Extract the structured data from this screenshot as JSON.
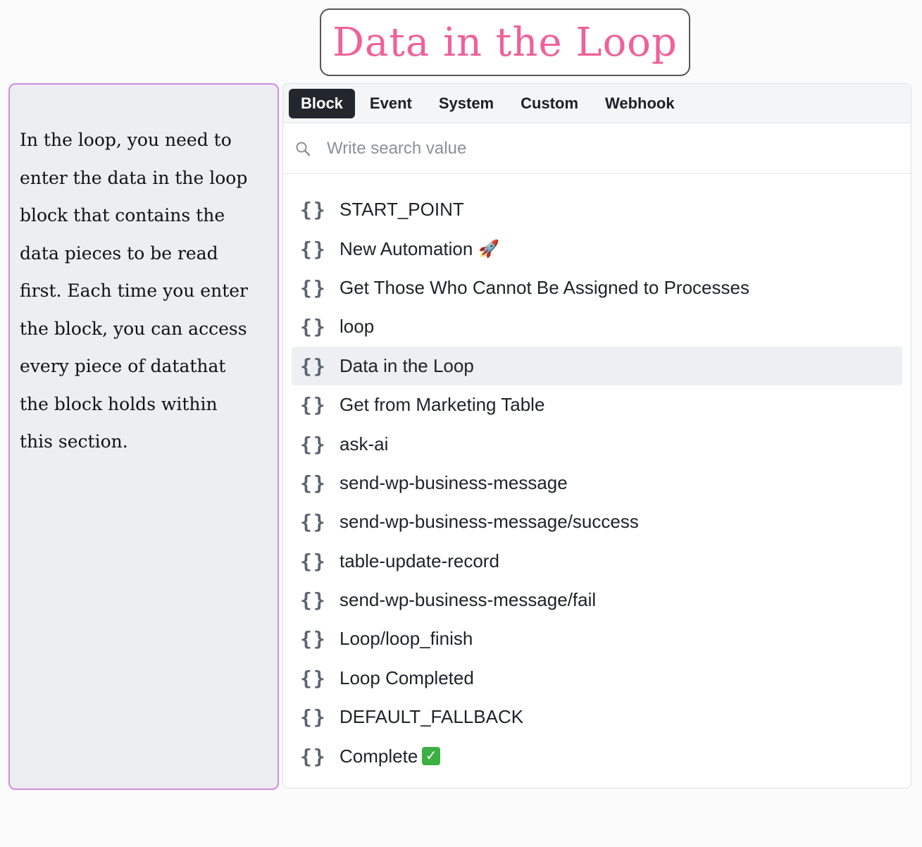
{
  "title": "Data in the Loop",
  "note": "In the loop, you need to\nenter the data in the loop\nblock that contains the\ndata pieces to be read\nfirst. Each time you enter\nthe block, you can access\nevery piece of datathat\nthe block holds within\nthis section.",
  "tabs": [
    {
      "label": "Block",
      "active": true
    },
    {
      "label": "Event",
      "active": false
    },
    {
      "label": "System",
      "active": false
    },
    {
      "label": "Custom",
      "active": false
    },
    {
      "label": "Webhook",
      "active": false
    }
  ],
  "search": {
    "placeholder": "Write search value",
    "icon": "search-icon"
  },
  "items": [
    {
      "label": "START_POINT",
      "icon": "brace-icon"
    },
    {
      "label": "New Automation",
      "icon": "brace-icon",
      "emoji": "🚀"
    },
    {
      "label": "Get Those Who Cannot Be Assigned to Processes",
      "icon": "brace-icon"
    },
    {
      "label": "loop",
      "icon": "brace-icon"
    },
    {
      "label": "Data in the Loop",
      "icon": "brace-icon",
      "selected": true
    },
    {
      "label": "Get from Marketing Table",
      "icon": "brace-icon"
    },
    {
      "label": "ask-ai",
      "icon": "brace-icon"
    },
    {
      "label": "send-wp-business-message",
      "icon": "brace-icon"
    },
    {
      "label": "send-wp-business-message/success",
      "icon": "brace-icon"
    },
    {
      "label": "table-update-record",
      "icon": "brace-icon"
    },
    {
      "label": "send-wp-business-message/fail",
      "icon": "brace-icon"
    },
    {
      "label": "Loop/loop_finish",
      "icon": "brace-icon"
    },
    {
      "label": "Loop Completed",
      "icon": "brace-icon"
    },
    {
      "label": "DEFAULT_FALLBACK",
      "icon": "brace-icon"
    },
    {
      "label": "Complete",
      "icon": "brace-icon",
      "check": "✓"
    }
  ],
  "brace_glyph": "{}",
  "colors": {
    "title": "#f0609a",
    "note_border": "#d48be0",
    "active_tab": "#22262d",
    "selected_row": "#edeff2",
    "check": "#3cb043"
  }
}
